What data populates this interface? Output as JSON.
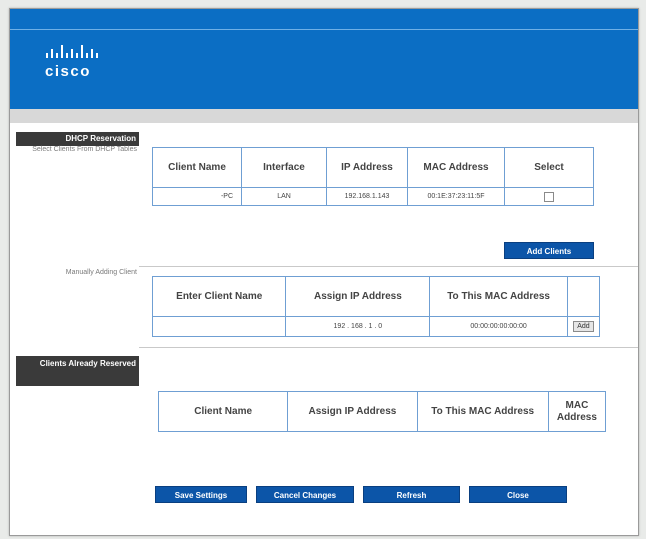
{
  "brand": {
    "logo_text": "cisco"
  },
  "sidebar": {
    "dhcp_reservation": "DHCP Reservation",
    "select_clients": "Select Clients From DHCP Tables",
    "manually_adding": "Manually Adding Client",
    "clients_reserved": "Clients Already Reserved"
  },
  "dhcp_table": {
    "headers": [
      "Client Name",
      "Interface",
      "IP Address",
      "MAC Address",
      "Select"
    ],
    "rows": [
      {
        "client_name": "-PC",
        "interface": "LAN",
        "ip": "192.168.1.143",
        "mac": "00:1E:37:23:11:5F",
        "selected": false
      }
    ]
  },
  "add_clients_label": "Add Clients",
  "manual_table": {
    "headers": [
      "Enter Client Name",
      "Assign IP Address",
      "To This MAC Address",
      ""
    ],
    "client_name_value": "",
    "ip_prefix": "192 . 168 . 1 .",
    "ip_last_octet": "0",
    "mac_value": "00:00:00:00:00:00",
    "add_label": "Add"
  },
  "reserved_table": {
    "headers": [
      "Client Name",
      "Assign IP Address",
      "To This MAC Address",
      "MAC Address"
    ]
  },
  "footer_buttons": {
    "save": "Save Settings",
    "cancel": "Cancel Changes",
    "refresh": "Refresh",
    "close": "Close"
  },
  "colors": {
    "header_blue": "#0b6ec4",
    "button_blue": "#0c55a8",
    "table_border": "#6f9fd3"
  }
}
